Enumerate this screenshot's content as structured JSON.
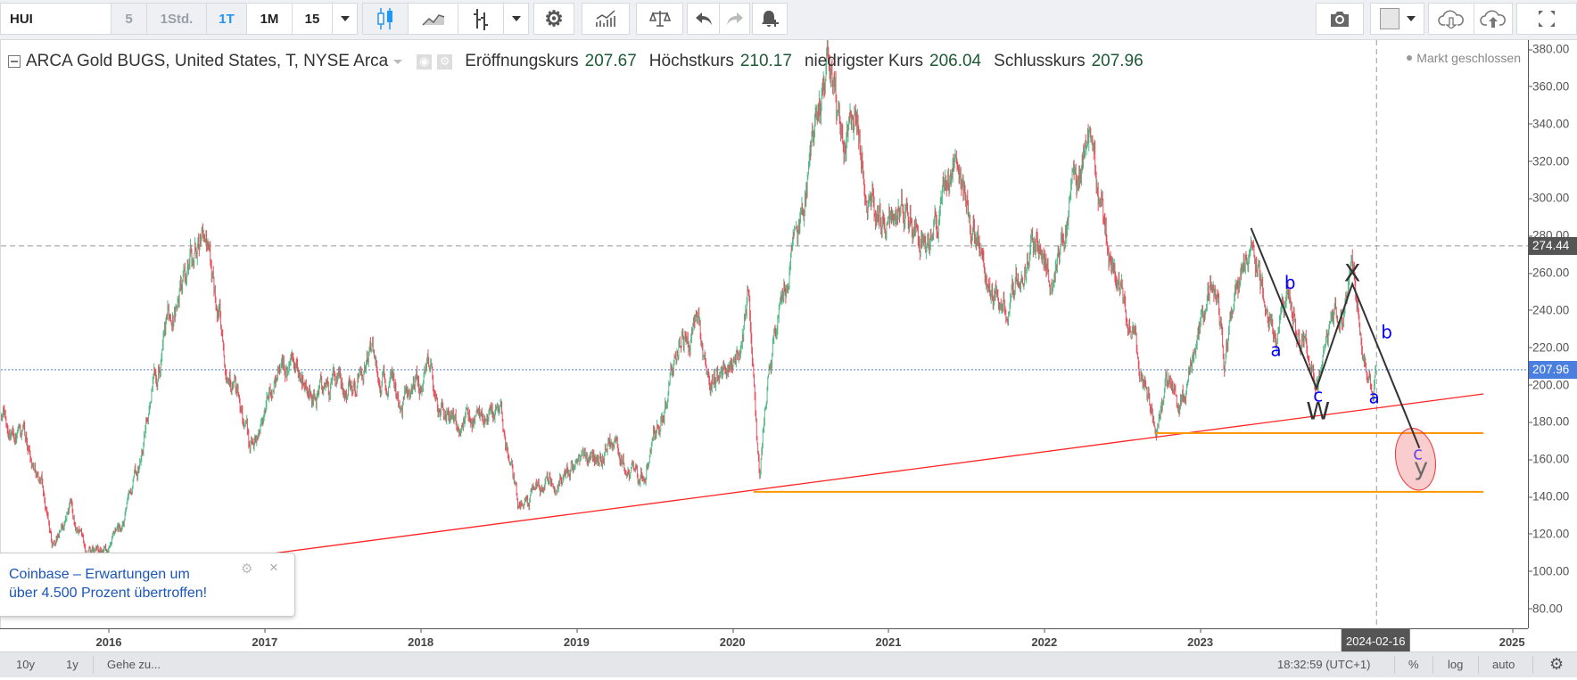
{
  "toolbar": {
    "symbol": "HUI",
    "intervals": [
      {
        "label": "5",
        "state": "muted"
      },
      {
        "label": "1Std.",
        "state": "muted"
      },
      {
        "label": "1T",
        "state": "active"
      },
      {
        "label": "1M",
        "state": "normal"
      },
      {
        "label": "15",
        "state": "normal"
      }
    ],
    "icons": [
      "chevron-down-icon",
      "candles-icon",
      "line-chart-icon",
      "bars-icon",
      "chevron-down-icon",
      "gear-icon",
      "indicators-icon",
      "compare-icon",
      "undo-icon",
      "redo-icon",
      "alert-icon",
      "camera-icon",
      "color-swatch-icon",
      "cloud-download-icon",
      "cloud-upload-icon",
      "fullscreen-icon"
    ]
  },
  "legend": {
    "title": "ARCA Gold BUGS, United States, T, NYSE Arca",
    "open_label": "Eröffnungskurs",
    "open": "207.67",
    "high_label": "Höchstkurs",
    "high": "210.17",
    "low_label": "niedrigster Kurs",
    "low": "206.04",
    "close_label": "Schlusskurs",
    "close": "207.96",
    "market_status": "Markt geschlossen"
  },
  "colors": {
    "up": "#53b987",
    "down": "#eb4d5c",
    "trendline": "#ff2222",
    "support": "#ff9800",
    "wave_label": "#0000ff",
    "last_price": "#4a7fe0"
  },
  "chart_data": {
    "type": "candlestick",
    "ylim": [
      70,
      385
    ],
    "y_ticks": [
      380,
      360,
      340,
      320,
      300,
      280,
      260,
      240,
      220,
      200,
      180,
      160,
      140,
      120,
      100,
      80
    ],
    "x_ticks": [
      {
        "year": 2016,
        "label": "2016"
      },
      {
        "year": 2017,
        "label": "2017"
      },
      {
        "year": 2018,
        "label": "2018"
      },
      {
        "year": 2019,
        "label": "2019"
      },
      {
        "year": 2020,
        "label": "2020"
      },
      {
        "year": 2021,
        "label": "2021"
      },
      {
        "year": 2022,
        "label": "2022"
      },
      {
        "year": 2023,
        "label": "2023"
      },
      {
        "year": 2025,
        "label": "2025"
      }
    ],
    "x_range": [
      2015.3,
      2024.9
    ],
    "price_path": [
      [
        2015.3,
        185
      ],
      [
        2015.45,
        170
      ],
      [
        2015.56,
        150
      ],
      [
        2015.63,
        113
      ],
      [
        2015.75,
        135
      ],
      [
        2015.85,
        108
      ],
      [
        2016.0,
        110
      ],
      [
        2016.08,
        120
      ],
      [
        2016.2,
        160
      ],
      [
        2016.27,
        200
      ],
      [
        2016.37,
        230
      ],
      [
        2016.53,
        270
      ],
      [
        2016.6,
        283
      ],
      [
        2016.69,
        250
      ],
      [
        2016.75,
        220
      ],
      [
        2016.9,
        163
      ],
      [
        2017.1,
        215
      ],
      [
        2017.3,
        195
      ],
      [
        2017.5,
        200
      ],
      [
        2017.68,
        215
      ],
      [
        2017.85,
        190
      ],
      [
        2018.0,
        200
      ],
      [
        2018.05,
        212
      ],
      [
        2018.12,
        186
      ],
      [
        2018.3,
        180
      ],
      [
        2018.5,
        183
      ],
      [
        2018.62,
        136
      ],
      [
        2018.8,
        150
      ],
      [
        2019.0,
        155
      ],
      [
        2019.2,
        170
      ],
      [
        2019.4,
        150
      ],
      [
        2019.55,
        185
      ],
      [
        2019.65,
        222
      ],
      [
        2019.75,
        232
      ],
      [
        2019.85,
        205
      ],
      [
        2020.0,
        215
      ],
      [
        2020.1,
        248
      ],
      [
        2020.17,
        145
      ],
      [
        2020.22,
        200
      ],
      [
        2020.3,
        238
      ],
      [
        2020.38,
        265
      ],
      [
        2020.45,
        292
      ],
      [
        2020.55,
        348
      ],
      [
        2020.6,
        366
      ],
      [
        2020.7,
        330
      ],
      [
        2020.8,
        338
      ],
      [
        2020.9,
        300
      ],
      [
        2021.0,
        282
      ],
      [
        2021.1,
        295
      ],
      [
        2021.25,
        270
      ],
      [
        2021.35,
        300
      ],
      [
        2021.42,
        323
      ],
      [
        2021.5,
        300
      ],
      [
        2021.6,
        268
      ],
      [
        2021.75,
        236
      ],
      [
        2021.85,
        262
      ],
      [
        2021.95,
        278
      ],
      [
        2022.05,
        256
      ],
      [
        2022.15,
        298
      ],
      [
        2022.22,
        318
      ],
      [
        2022.27,
        337
      ],
      [
        2022.38,
        280
      ],
      [
        2022.48,
        255
      ],
      [
        2022.58,
        220
      ],
      [
        2022.65,
        198
      ],
      [
        2022.71,
        175
      ],
      [
        2022.8,
        200
      ],
      [
        2022.86,
        182
      ],
      [
        2023.0,
        230
      ],
      [
        2023.08,
        262
      ],
      [
        2023.15,
        215
      ],
      [
        2023.22,
        242
      ],
      [
        2023.32,
        282
      ],
      [
        2023.42,
        240
      ],
      [
        2023.48,
        222
      ],
      [
        2023.57,
        248
      ],
      [
        2023.74,
        199
      ],
      [
        2023.85,
        230
      ],
      [
        2023.97,
        253
      ],
      [
        2024.05,
        222
      ],
      [
        2024.1,
        201
      ],
      [
        2024.125,
        207.96
      ]
    ],
    "last_bar": {
      "date": "2024-02-16",
      "open": 207.67,
      "high": 210.17,
      "low": 206.04,
      "close": 207.96
    },
    "price_lines": [
      {
        "price": 274.44,
        "label": "274.44",
        "style": "dashed"
      },
      {
        "price": 207.96,
        "label": "207.96",
        "style": "dotted"
      }
    ],
    "crosshair_date": "2024-02-16",
    "crosshair_t": 2024.125,
    "trendline": {
      "from": [
        2016.915,
        108
      ],
      "to": [
        2024.81,
        195
      ]
    },
    "horizontal_supports": [
      {
        "from_t": 2022.71,
        "to_t": 2024.81,
        "price": 174
      },
      {
        "from_t": 2020.13,
        "to_t": 2024.81,
        "price": 142.5
      }
    ],
    "wave_path": [
      [
        2023.32,
        284
      ],
      [
        2023.74,
        198
      ],
      [
        2023.97,
        254
      ],
      [
        2024.4,
        166
      ]
    ],
    "target_zone": {
      "t": 2024.375,
      "price": 160
    },
    "wave_labels": [
      {
        "text": "b",
        "t": 2023.57,
        "price": 254,
        "kind": "minor"
      },
      {
        "text": "a",
        "t": 2023.48,
        "price": 218,
        "kind": "minor"
      },
      {
        "text": "c",
        "t": 2023.75,
        "price": 193.5,
        "kind": "minor"
      },
      {
        "text": "W",
        "t": 2023.75,
        "price": 185,
        "kind": "major"
      },
      {
        "text": "X",
        "t": 2023.97,
        "price": 259,
        "kind": "major"
      },
      {
        "text": "b",
        "t": 2024.19,
        "price": 227.5,
        "kind": "minor"
      },
      {
        "text": "a",
        "t": 2024.11,
        "price": 192.6,
        "kind": "minor"
      },
      {
        "text": "c",
        "t": 2024.39,
        "price": 162.5,
        "kind": "target-minor"
      },
      {
        "text": "y",
        "t": 2024.41,
        "price": 155,
        "kind": "target-major"
      }
    ]
  },
  "popup": {
    "line1": "Coinbase – Erwartungen um",
    "line2": "über 4.500 Prozent übertroffen!"
  },
  "bottombar": {
    "range_10y": "10y",
    "range_1y": "1y",
    "goto": "Gehe zu...",
    "clock": "18:32:59 (UTC+1)",
    "percent": "%",
    "log": "log",
    "auto": "auto"
  }
}
